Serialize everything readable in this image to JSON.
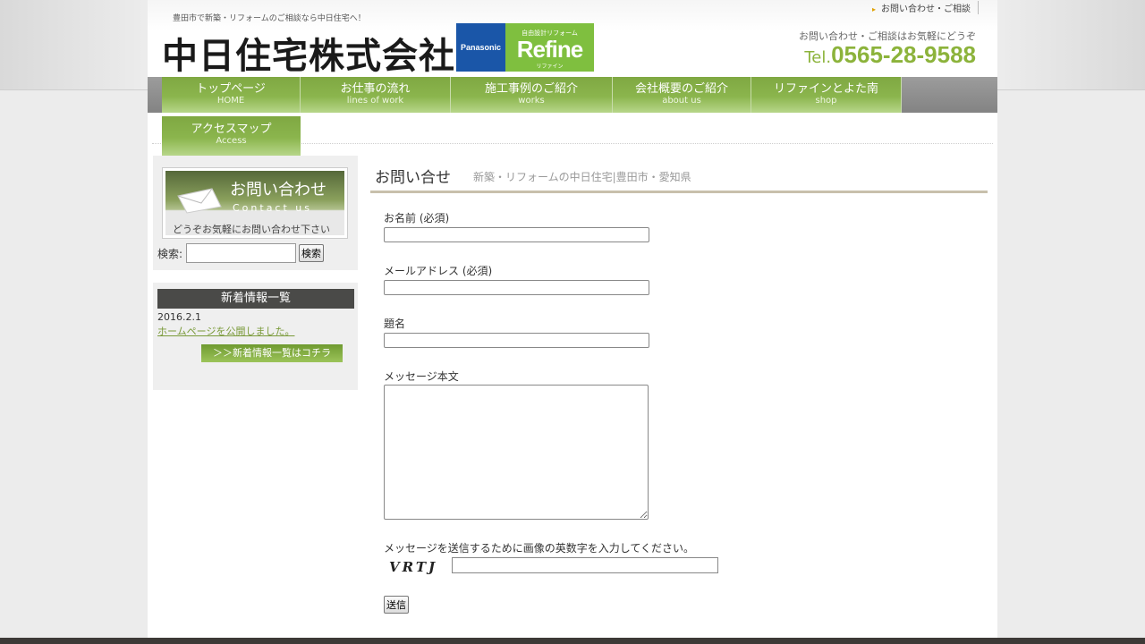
{
  "header": {
    "tagline": "豊田市で新築・リフォームのご相談なら中日住宅へ！",
    "company_name": "中日住宅株式会社",
    "badge": {
      "brand": "Panasonic",
      "sub": "自由設計リフォーム",
      "name": "Refine",
      "kana": "リファイン"
    },
    "top_link": "お問い合わせ・ご相談",
    "contact_hint": "お問い合わせ・ご相談はお気軽にどうぞ",
    "tel_label": "Tel.",
    "tel_number": "0565-28-9588"
  },
  "nav": {
    "items": [
      {
        "ja": "トップページ",
        "en": "HOME"
      },
      {
        "ja": "お仕事の流れ",
        "en": "lines of work"
      },
      {
        "ja": "施工事例のご紹介",
        "en": "works"
      },
      {
        "ja": "会社概要のご紹介",
        "en": "about us"
      },
      {
        "ja": "リファインとよた南",
        "en": "shop"
      }
    ],
    "row2": {
      "ja": "アクセスマップ",
      "en": "Access"
    }
  },
  "sidebar": {
    "contact_banner": {
      "title": "お問い合わせ",
      "sub": "Contact us",
      "note": "どうぞお気軽にお問い合わせ下さい"
    },
    "search_label": "検索:",
    "search_button": "検索",
    "news": {
      "heading": "新着情報一覧",
      "date": "2016.2.1",
      "link": "ホームページを公開しました。",
      "more": "＞＞新着情報一覧はコチラ"
    }
  },
  "main": {
    "title": "お問い合せ",
    "subtitle": "新築・リフォームの中日住宅|豊田市・愛知県",
    "form": {
      "name_label": "お名前 (必須)",
      "email_label": "メールアドレス (必須)",
      "subject_label": "題名",
      "message_label": "メッセージ本文",
      "captcha_label": "メッセージを送信するために画像の英数字を入力してください。",
      "captcha_text": "VRTJ",
      "submit": "送信"
    }
  }
}
